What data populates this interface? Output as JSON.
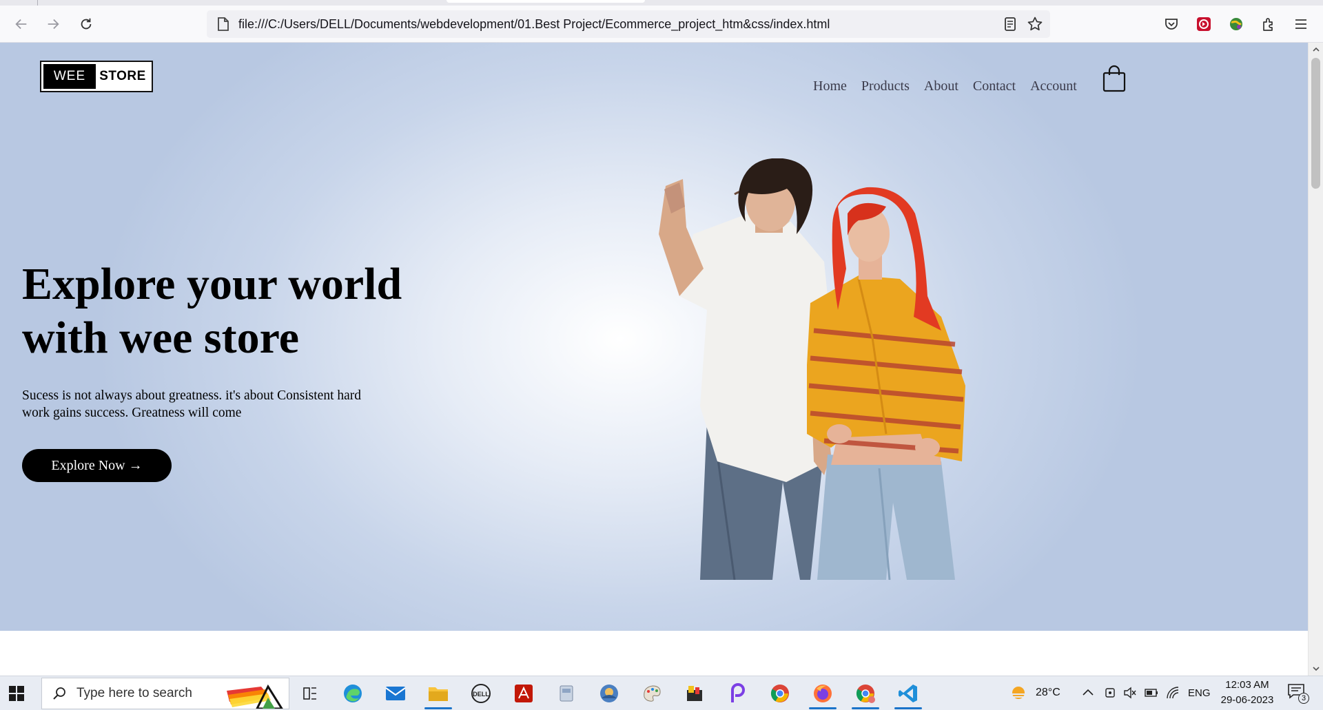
{
  "browser": {
    "url": "file:///C:/Users/DELL/Documents/webdevelopment/01.Best Project/Ecommerce_project_htm&css/index.html"
  },
  "site": {
    "logo": {
      "left": "WEE",
      "right": "STORE"
    },
    "nav": [
      {
        "label": "Home"
      },
      {
        "label": "Products"
      },
      {
        "label": "About"
      },
      {
        "label": "Contact"
      },
      {
        "label": "Account"
      }
    ],
    "hero": {
      "title_line1": "Explore your world",
      "title_line2": "with wee store",
      "subtitle": "Sucess is not always about greatness. it's about Consistent hard work gains success. Greatness will come",
      "cta": "Explore Now →"
    }
  },
  "taskbar": {
    "search_placeholder": "Type here to search",
    "weather": "28°C",
    "language": "ENG",
    "time": "12:03 AM",
    "date": "29-06-2023",
    "notification_count": "3"
  },
  "colors": {
    "hero_edge": "#b8c8e2",
    "cta_bg": "#000000",
    "taskbar_bg": "#e8ecf3"
  }
}
